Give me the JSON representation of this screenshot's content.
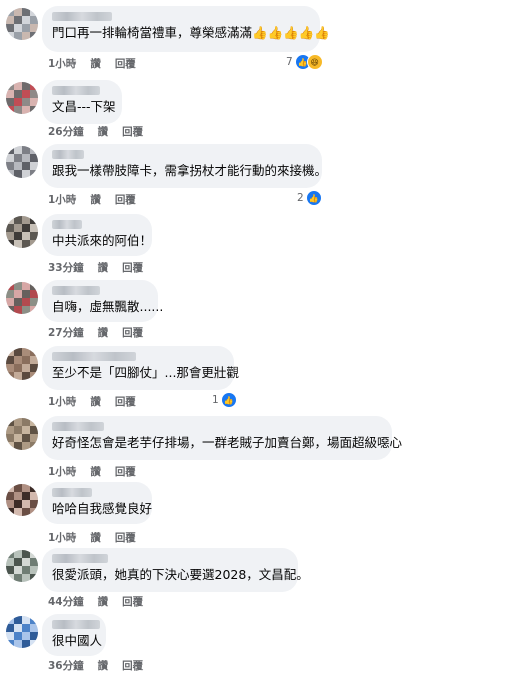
{
  "actions": {
    "like": "讚",
    "reply": "回覆"
  },
  "comments": [
    {
      "text": "門口再一排輪椅當禮車，尊榮感滿滿👍👍👍👍👍",
      "time": "1小時",
      "reaction_count": "7",
      "reaction_icons": [
        "like-icon",
        "haha-icon"
      ],
      "avatar_colors": [
        "#9aa0a8",
        "#c9b8b0",
        "#6d6f74",
        "#d2d5da"
      ]
    },
    {
      "text": "文昌---下架",
      "time": "26分鐘",
      "reaction_count": "",
      "reaction_icons": [],
      "avatar_colors": [
        "#c04d55",
        "#8e8a88",
        "#d9b3b0",
        "#6e6a6b"
      ]
    },
    {
      "text": "跟我一樣帶肢障卡，需拿拐杖才能行動的來接機。",
      "time": "1小時",
      "reaction_count": "2",
      "reaction_icons": [
        "like-icon"
      ],
      "avatar_colors": [
        "#7d7f86",
        "#b6b8be",
        "#5e6067",
        "#cfd1d5"
      ]
    },
    {
      "text": "中共派來的阿伯！",
      "time": "33分鐘",
      "reaction_count": "",
      "reaction_icons": [],
      "avatar_colors": [
        "#5c5852",
        "#a39a8f",
        "#3e3b38",
        "#c7c0b7"
      ]
    },
    {
      "text": "自嗨，虛無飄散......",
      "time": "27分鐘",
      "reaction_count": "",
      "reaction_icons": [],
      "avatar_colors": [
        "#b24a4f",
        "#8c8f86",
        "#d7a7a5",
        "#66605d"
      ]
    },
    {
      "text": "至少不是「四腳仗」...那會更壯觀",
      "time": "1小時",
      "reaction_count": "1",
      "reaction_icons": [
        "like-icon"
      ],
      "avatar_colors": [
        "#8a6e5c",
        "#c3ab99",
        "#5b4a3f",
        "#a98c79"
      ]
    },
    {
      "text": "好奇怪怎會是老芋仔排場，一群老賊子加賣台鄭，場面超級噁心",
      "time": "1小時",
      "reaction_count": "",
      "reaction_icons": [],
      "avatar_colors": [
        "#8b7a66",
        "#c7b59f",
        "#5f5244",
        "#ad9a84"
      ]
    },
    {
      "text": "哈哈自我感覺良好",
      "time": "1小時",
      "reaction_count": "",
      "reaction_icons": [],
      "avatar_colors": [
        "#6a4e44",
        "#b09083",
        "#3d2c27",
        "#d3b9ae"
      ]
    },
    {
      "text": "很愛派頭，她真的下決心要選2028，文昌配。",
      "time": "44分鐘",
      "reaction_count": "",
      "reaction_icons": [],
      "avatar_colors": [
        "#6f7d74",
        "#b8c2bb",
        "#4c564f",
        "#d3d8d4"
      ]
    },
    {
      "text": "很中國人",
      "time": "36分鐘",
      "reaction_count": "",
      "reaction_icons": [],
      "avatar_colors": [
        "#4c82c8",
        "#a9c4ea",
        "#2f5c99",
        "#d5e2f3"
      ]
    }
  ]
}
